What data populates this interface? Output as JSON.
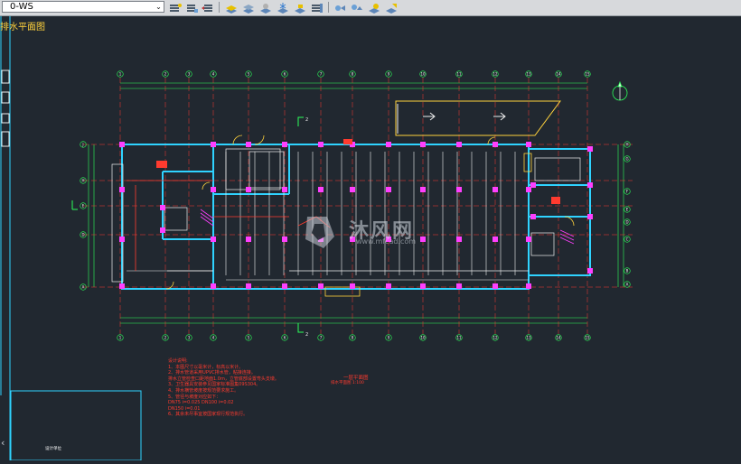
{
  "toolbar": {
    "layer_name": "0-WS",
    "layer_dropdown_glyph": "⌄",
    "buttons": [
      {
        "icon": "layer-properties-icon"
      },
      {
        "icon": "layer-states-icon"
      },
      {
        "icon": "layer-previous-icon"
      },
      {
        "icon": "layer-isolate-icon"
      },
      {
        "icon": "layer-unisolate-icon"
      },
      {
        "icon": "layer-off-icon"
      },
      {
        "icon": "layer-freeze-icon"
      },
      {
        "icon": "layer-lock-icon"
      },
      {
        "icon": "layer-match-icon"
      },
      {
        "icon": "layer-walk-icon"
      },
      {
        "icon": "layer-merge-icon"
      },
      {
        "icon": "layer-delete-icon"
      }
    ]
  },
  "drawing": {
    "title_fragment": "排水平面图",
    "grid_top": [
      "1",
      "2",
      "3",
      "4",
      "5",
      "6",
      "7",
      "8",
      "9",
      "10",
      "11",
      "12",
      "13",
      "14",
      "15"
    ],
    "grid_left": [
      "J",
      "H",
      "E",
      "D",
      "A"
    ],
    "grid_right": [
      "H",
      "G",
      "F",
      "E",
      "D",
      "C",
      "B",
      "A"
    ],
    "section_marker": "2",
    "notes": [
      "设计说明:",
      "1、本图尺寸以毫米计，标高以米计。",
      "2、排水管道采用UPVC排水管，粘接连接。",
      "   排水立管检查口距地面1.0m，立管底部设置弯头支墩。",
      "3、卫生器具安装参见国家标准图集09S304。",
      "4、排水横管坡度按规范要求施工。",
      "5、管径与坡度对应如下：",
      "   DN75  i=0.025   DN100  i=0.02",
      "   DN150  i=0.01",
      "6、其余未尽事宜按国家现行规范执行。"
    ],
    "section_title": "一层平面图",
    "section_sub": "排水平面图 1:100",
    "title_block_label": "设计单位"
  },
  "watermark": {
    "brand": "沐风网",
    "url": "www.mfcad.com"
  },
  "colors": {
    "background": "#212830",
    "wall_cyan": "#2fd3ff",
    "grid_green": "#2cff5a",
    "column_magenta": "#ff3fff",
    "pipe_red": "#ff3b2f",
    "yellow": "#ffd23c",
    "white": "#f0f0f0"
  }
}
